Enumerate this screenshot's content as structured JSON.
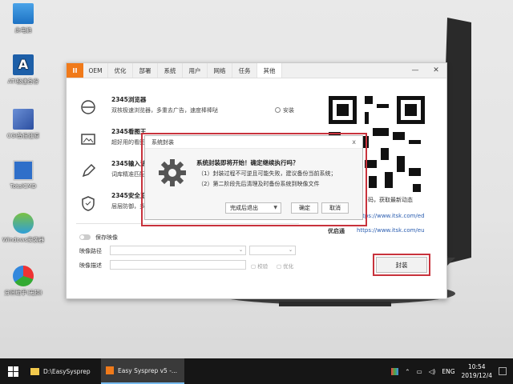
{
  "desktop": {
    "icons": [
      {
        "label": "此电脑"
      },
      {
        "label": "ATI极速备份"
      },
      {
        "label": "CGI备份还原"
      },
      {
        "label": "TotalCMD"
      },
      {
        "label": "Windows安装器"
      },
      {
        "label": "分区助手(无损)"
      }
    ]
  },
  "window": {
    "tabs": [
      "OEM",
      "优化",
      "部署",
      "系统",
      "用户",
      "网络",
      "任务",
      "其他"
    ],
    "active_tab": "其他",
    "controls": {
      "minimize": "—",
      "close": "✕"
    },
    "software": [
      {
        "title": "2345浏览器",
        "desc": "双核极速浏览器，多重去广告，速度棒棒哒",
        "check": "安装"
      },
      {
        "title": "2345看图王",
        "desc": "超好用的看图"
      },
      {
        "title": "2345输入法",
        "desc": "词库精准匹配"
      },
      {
        "title": "2345安全卫士",
        "desc": "层层防御，多"
      }
    ],
    "save_image": "保存映像",
    "image_path_label": "映像路径",
    "image_desc_label": "映像描述",
    "verify_label": "校验",
    "optimize_label": "优化",
    "qr_caption": "码，获取最新动态",
    "site1": "https://www.itsk.com/ed",
    "site2_label": "优启通",
    "site2": "https://www.itsk.com/eu",
    "pack_button": "封装"
  },
  "dialog": {
    "title": "系统封装",
    "close": "x",
    "question": "系统封装即将开始！确定继续执行吗？",
    "line1": "（1）封装过程不可逆且可能失败，建议备份当前系统；",
    "line2": "（2）第二阶段先后清理及时备份系统到映像文件",
    "select_value": "完成后退出",
    "ok": "确定",
    "cancel": "取消"
  },
  "taskbar": {
    "items": [
      {
        "label": "D:\\EasySysprep"
      },
      {
        "label": "Easy Sysprep v5 -..."
      }
    ],
    "lang": "ENG",
    "time": "10:54",
    "date": "2019/12/4"
  },
  "colors": {
    "accent": "#f07a1a",
    "highlight": "#c8323c",
    "taskbar": "#161616"
  }
}
